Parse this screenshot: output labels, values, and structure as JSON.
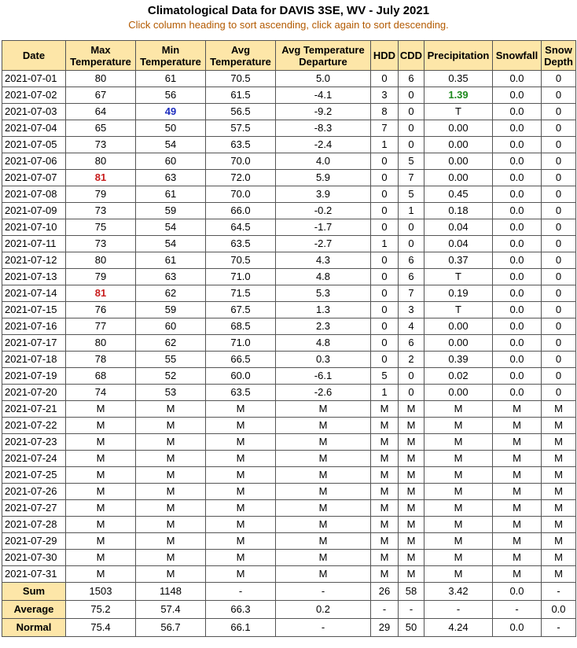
{
  "title": "Climatological Data for DAVIS 3SE, WV - July 2021",
  "subtitle": "Click column heading to sort ascending, click again to sort descending.",
  "columns": [
    {
      "key": "date",
      "label": "Date"
    },
    {
      "key": "max",
      "label": "Max Temperature"
    },
    {
      "key": "min",
      "label": "Min Temperature"
    },
    {
      "key": "avg",
      "label": "Avg Temperature"
    },
    {
      "key": "dep",
      "label": "Avg Temperature Departure"
    },
    {
      "key": "hdd",
      "label": "HDD"
    },
    {
      "key": "cdd",
      "label": "CDD"
    },
    {
      "key": "pcp",
      "label": "Precipitation"
    },
    {
      "key": "snow",
      "label": "Snowfall"
    },
    {
      "key": "depth",
      "label": "Snow Depth"
    }
  ],
  "colors": {
    "header_bg": "#fde6a8",
    "subtitle": "#b35a00",
    "record_high": "#c81e1e",
    "record_low": "#1f2fbf",
    "record_precip": "#1e8a1e",
    "border": "#555555"
  },
  "highlights": {
    "max_temp": "81",
    "min_temp": "49",
    "precip": "1.39"
  },
  "rows": [
    [
      "2021-07-01",
      "80",
      "61",
      "70.5",
      "5.0",
      "0",
      "6",
      "0.35",
      "0.0",
      "0"
    ],
    [
      "2021-07-02",
      "67",
      "56",
      "61.5",
      "-4.1",
      "3",
      "0",
      "1.39",
      "0.0",
      "0"
    ],
    [
      "2021-07-03",
      "64",
      "49",
      "56.5",
      "-9.2",
      "8",
      "0",
      "T",
      "0.0",
      "0"
    ],
    [
      "2021-07-04",
      "65",
      "50",
      "57.5",
      "-8.3",
      "7",
      "0",
      "0.00",
      "0.0",
      "0"
    ],
    [
      "2021-07-05",
      "73",
      "54",
      "63.5",
      "-2.4",
      "1",
      "0",
      "0.00",
      "0.0",
      "0"
    ],
    [
      "2021-07-06",
      "80",
      "60",
      "70.0",
      "4.0",
      "0",
      "5",
      "0.00",
      "0.0",
      "0"
    ],
    [
      "2021-07-07",
      "81",
      "63",
      "72.0",
      "5.9",
      "0",
      "7",
      "0.00",
      "0.0",
      "0"
    ],
    [
      "2021-07-08",
      "79",
      "61",
      "70.0",
      "3.9",
      "0",
      "5",
      "0.45",
      "0.0",
      "0"
    ],
    [
      "2021-07-09",
      "73",
      "59",
      "66.0",
      "-0.2",
      "0",
      "1",
      "0.18",
      "0.0",
      "0"
    ],
    [
      "2021-07-10",
      "75",
      "54",
      "64.5",
      "-1.7",
      "0",
      "0",
      "0.04",
      "0.0",
      "0"
    ],
    [
      "2021-07-11",
      "73",
      "54",
      "63.5",
      "-2.7",
      "1",
      "0",
      "0.04",
      "0.0",
      "0"
    ],
    [
      "2021-07-12",
      "80",
      "61",
      "70.5",
      "4.3",
      "0",
      "6",
      "0.37",
      "0.0",
      "0"
    ],
    [
      "2021-07-13",
      "79",
      "63",
      "71.0",
      "4.8",
      "0",
      "6",
      "T",
      "0.0",
      "0"
    ],
    [
      "2021-07-14",
      "81",
      "62",
      "71.5",
      "5.3",
      "0",
      "7",
      "0.19",
      "0.0",
      "0"
    ],
    [
      "2021-07-15",
      "76",
      "59",
      "67.5",
      "1.3",
      "0",
      "3",
      "T",
      "0.0",
      "0"
    ],
    [
      "2021-07-16",
      "77",
      "60",
      "68.5",
      "2.3",
      "0",
      "4",
      "0.00",
      "0.0",
      "0"
    ],
    [
      "2021-07-17",
      "80",
      "62",
      "71.0",
      "4.8",
      "0",
      "6",
      "0.00",
      "0.0",
      "0"
    ],
    [
      "2021-07-18",
      "78",
      "55",
      "66.5",
      "0.3",
      "0",
      "2",
      "0.39",
      "0.0",
      "0"
    ],
    [
      "2021-07-19",
      "68",
      "52",
      "60.0",
      "-6.1",
      "5",
      "0",
      "0.02",
      "0.0",
      "0"
    ],
    [
      "2021-07-20",
      "74",
      "53",
      "63.5",
      "-2.6",
      "1",
      "0",
      "0.00",
      "0.0",
      "0"
    ],
    [
      "2021-07-21",
      "M",
      "M",
      "M",
      "M",
      "M",
      "M",
      "M",
      "M",
      "M"
    ],
    [
      "2021-07-22",
      "M",
      "M",
      "M",
      "M",
      "M",
      "M",
      "M",
      "M",
      "M"
    ],
    [
      "2021-07-23",
      "M",
      "M",
      "M",
      "M",
      "M",
      "M",
      "M",
      "M",
      "M"
    ],
    [
      "2021-07-24",
      "M",
      "M",
      "M",
      "M",
      "M",
      "M",
      "M",
      "M",
      "M"
    ],
    [
      "2021-07-25",
      "M",
      "M",
      "M",
      "M",
      "M",
      "M",
      "M",
      "M",
      "M"
    ],
    [
      "2021-07-26",
      "M",
      "M",
      "M",
      "M",
      "M",
      "M",
      "M",
      "M",
      "M"
    ],
    [
      "2021-07-27",
      "M",
      "M",
      "M",
      "M",
      "M",
      "M",
      "M",
      "M",
      "M"
    ],
    [
      "2021-07-28",
      "M",
      "M",
      "M",
      "M",
      "M",
      "M",
      "M",
      "M",
      "M"
    ],
    [
      "2021-07-29",
      "M",
      "M",
      "M",
      "M",
      "M",
      "M",
      "M",
      "M",
      "M"
    ],
    [
      "2021-07-30",
      "M",
      "M",
      "M",
      "M",
      "M",
      "M",
      "M",
      "M",
      "M"
    ],
    [
      "2021-07-31",
      "M",
      "M",
      "M",
      "M",
      "M",
      "M",
      "M",
      "M",
      "M"
    ]
  ],
  "summary": [
    {
      "label": "Sum",
      "values": [
        "1503",
        "1148",
        "-",
        "-",
        "26",
        "58",
        "3.42",
        "0.0",
        "-"
      ]
    },
    {
      "label": "Average",
      "values": [
        "75.2",
        "57.4",
        "66.3",
        "0.2",
        "-",
        "-",
        "-",
        "-",
        "0.0"
      ]
    },
    {
      "label": "Normal",
      "values": [
        "75.4",
        "56.7",
        "66.1",
        "-",
        "29",
        "50",
        "4.24",
        "0.0",
        "-"
      ]
    }
  ]
}
